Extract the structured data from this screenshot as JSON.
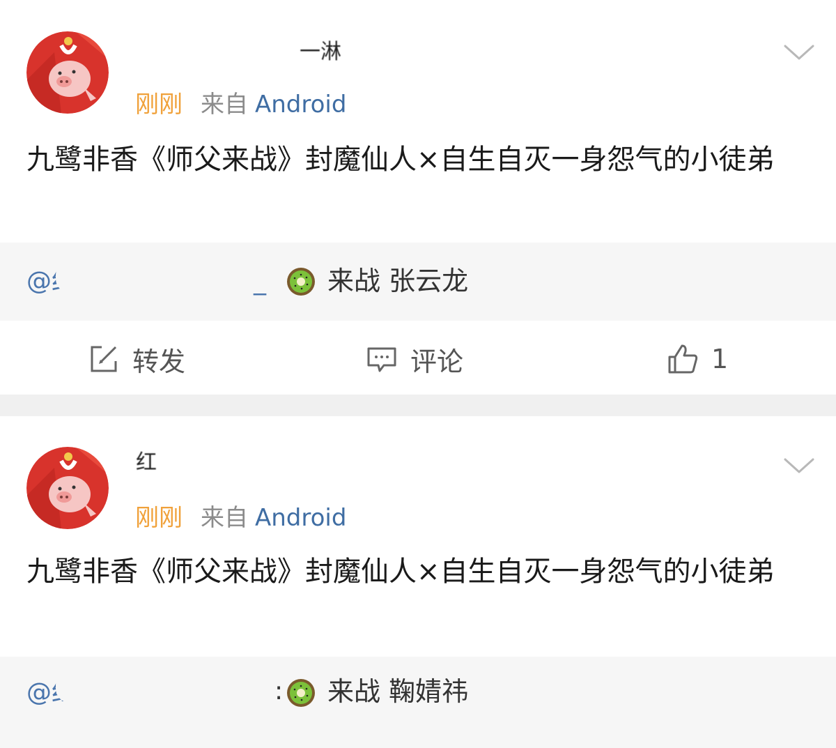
{
  "posts": [
    {
      "username_fragment": "一淋",
      "time": "刚刚",
      "source_prefix": "来自",
      "source_device": "Android",
      "content": "九鹭非香《师父来战》封魔仙人×自生自灭一身怨气的小徒弟",
      "quote": {
        "mention_prefix": "@红",
        "mention_suffix": "_",
        "comment": "来战 张云龙"
      },
      "actions": {
        "repost_label": "转发",
        "comment_label": "评论",
        "like_count": "1"
      }
    },
    {
      "username_fragment": "红",
      "time": "刚刚",
      "source_prefix": "来自",
      "source_device": "Android",
      "content": "九鹭非香《师父来战》封魔仙人×自生自灭一身怨气的小徒弟",
      "quote": {
        "mention_prefix": "@红",
        "colon": ":",
        "comment": "来战 鞠婧祎"
      }
    }
  ],
  "icons": {
    "more": "chevron-down-icon",
    "repost": "repost-icon",
    "comment": "comment-icon",
    "like": "thumbs-up-icon",
    "emoji": "kiwi-emoji"
  },
  "colors": {
    "time": "#f0a13a",
    "device": "#3f6da3",
    "mention": "#4a75ad",
    "quote_bg": "#f6f6f6",
    "separator": "#f0f0f0"
  }
}
